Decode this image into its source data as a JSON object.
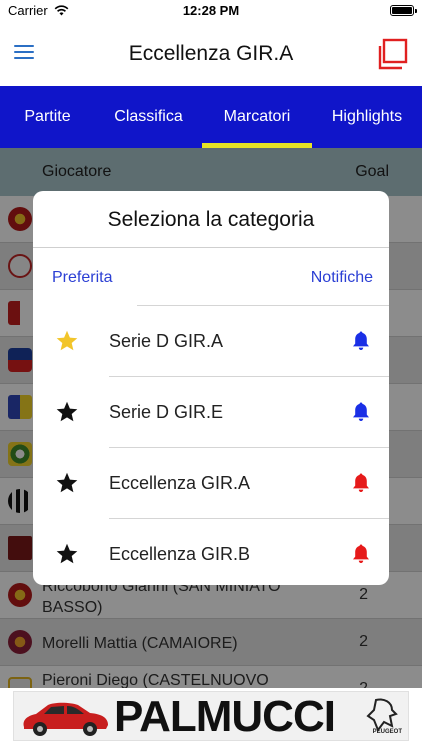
{
  "status_bar": {
    "carrier": "Carrier",
    "time": "12:28 PM"
  },
  "nav": {
    "title": "Eccellenza GIR.A"
  },
  "tabs": [
    {
      "label": "Partite"
    },
    {
      "label": "Classifica"
    },
    {
      "label": "Marcatori"
    },
    {
      "label": "Highlights"
    }
  ],
  "table": {
    "header_player": "Giocatore",
    "header_goal": "Goal",
    "visible_rows": [
      {
        "name": "Riccobono Gianni (SAN MINIATO BASSO)",
        "goal": "2"
      },
      {
        "name": "Morelli Mattia (CAMAIORE)",
        "goal": "2"
      },
      {
        "name": "Pieroni Diego (CASTELNUOVO",
        "goal": "2"
      }
    ]
  },
  "modal": {
    "title": "Seleziona la categoria",
    "left_header": "Preferita",
    "right_header": "Notifiche",
    "categories": [
      {
        "label": "Serie D GIR.A",
        "star_color": "#f2c52a",
        "bell_color": "#1a2fe6"
      },
      {
        "label": "Serie D GIR.E",
        "star_color": "#111111",
        "bell_color": "#1a2fe6"
      },
      {
        "label": "Eccellenza GIR.A",
        "star_color": "#111111",
        "bell_color": "#e61a1a"
      },
      {
        "label": "Eccellenza GIR.B",
        "star_color": "#111111",
        "bell_color": "#e61a1a"
      }
    ]
  },
  "ad": {
    "brand": "PALMUCCI",
    "logo_text": "PEUGEOT"
  },
  "colors": {
    "tab_bar": "#1015c9",
    "tab_indicator": "#e6e325",
    "accent_red": "#e02020",
    "link_blue": "#2b3fd4"
  }
}
